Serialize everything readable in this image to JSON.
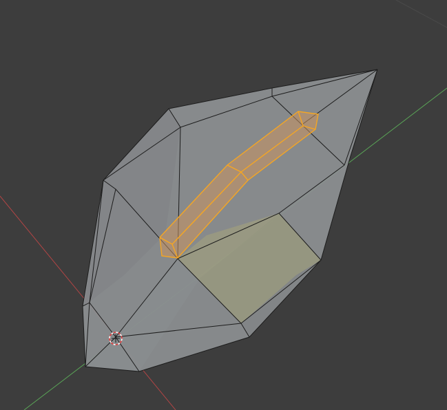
{
  "viewport": {
    "mode": "edit-mode",
    "view": "perspective"
  },
  "colors": {
    "background": "#3d3d3d",
    "mesh_face": "#8f9294",
    "mesh_face_dark": "#7d8083",
    "mesh_edge": "#1c1c1c",
    "selection_edge": "#f5a623",
    "selection_face": "#c89460",
    "highlight_face": "#a5a47a",
    "x_axis": "#b34545",
    "y_axis": "#5aa557",
    "cursor_ring_red": "#e04040",
    "cursor_ring_white": "#ffffff"
  },
  "icons": {
    "cursor": "3d-cursor-icon"
  }
}
